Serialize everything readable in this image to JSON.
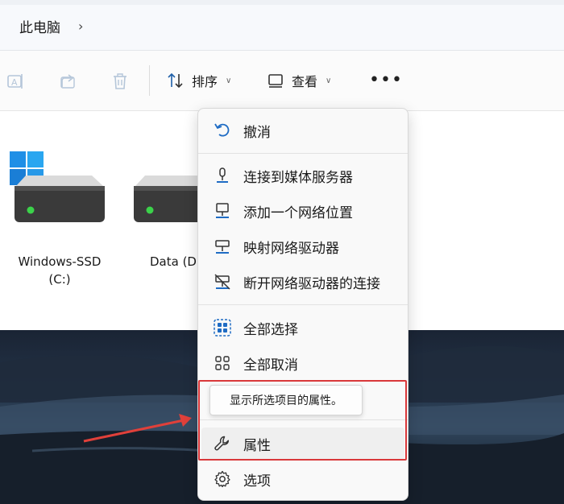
{
  "address": {
    "location": "此电脑",
    "chevron": "›"
  },
  "toolbar": {
    "icons": [
      "rename-icon",
      "share-icon",
      "delete-icon"
    ],
    "sort_label": "排序",
    "view_label": "查看",
    "more_label": "•••"
  },
  "drives": [
    {
      "label": "Windows-SSD\n(C:)",
      "line1": "Windows-SSD",
      "line2": "(C:)",
      "has_windows_logo": true
    },
    {
      "label": "Data (D",
      "line1": "Data (D",
      "line2": "",
      "has_windows_logo": false
    }
  ],
  "menu": {
    "items": [
      {
        "label": "撤消",
        "icon": "undo-icon"
      },
      {
        "label": "连接到媒体服务器",
        "icon": "media-server-icon"
      },
      {
        "label": "添加一个网络位置",
        "icon": "network-location-icon"
      },
      {
        "label": "映射网络驱动器",
        "icon": "map-drive-icon"
      },
      {
        "label": "断开网络驱动器的连接",
        "icon": "disconnect-drive-icon"
      },
      {
        "label": "全部选择",
        "icon": "select-all-icon"
      },
      {
        "label": "全部取消",
        "icon": "select-none-icon"
      },
      {
        "label": "属性",
        "icon": "wrench-icon"
      },
      {
        "label": "选项",
        "icon": "gear-icon"
      }
    ],
    "tooltip": "显示所选项目的属性。"
  },
  "colors": {
    "accent": "#0067c0",
    "highlight_border": "#d9383a",
    "arrow": "#e0403a",
    "drive_led": "#3bd24a"
  }
}
